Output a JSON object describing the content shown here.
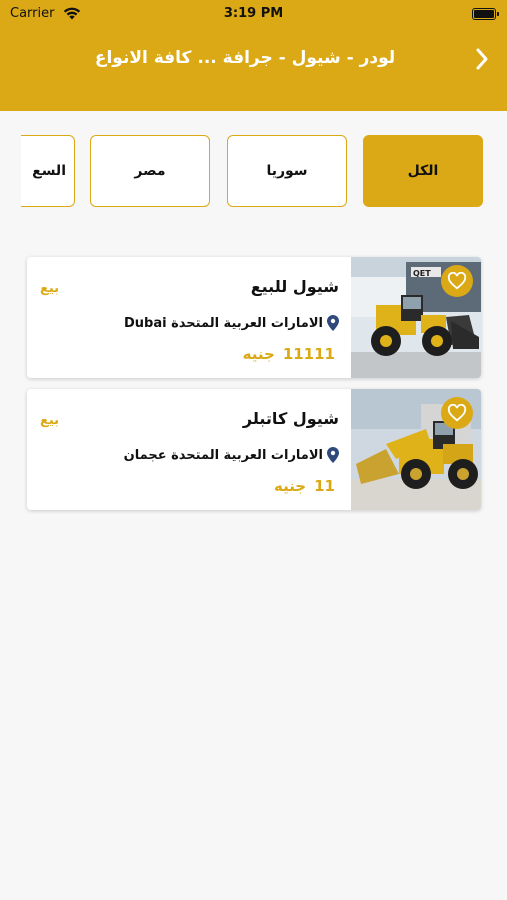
{
  "status_bar": {
    "carrier": "Carrier",
    "time": "3:19 PM"
  },
  "header": {
    "title": "لودر - شيول - جرافة ... كافة الانواع",
    "back_icon": "chevron-right-icon"
  },
  "tabs": [
    {
      "label": "الكل",
      "active": true
    },
    {
      "label": "سوريا",
      "active": false
    },
    {
      "label": "مصر",
      "active": false
    },
    {
      "label": "السع",
      "active": false
    }
  ],
  "listings": [
    {
      "name": "شيول للبيع",
      "location": "الامارات العربية المتحدة Dubai",
      "price_value": "11111",
      "currency": "جنيه",
      "type": "بيع"
    },
    {
      "name": "شيول كاتبلر",
      "location": "الامارات العربية المتحدة عجمان",
      "price_value": "11",
      "currency": "جنيه",
      "type": "بيع"
    }
  ],
  "colors": {
    "accent": "#dba915",
    "background": "#f7f7f7"
  }
}
